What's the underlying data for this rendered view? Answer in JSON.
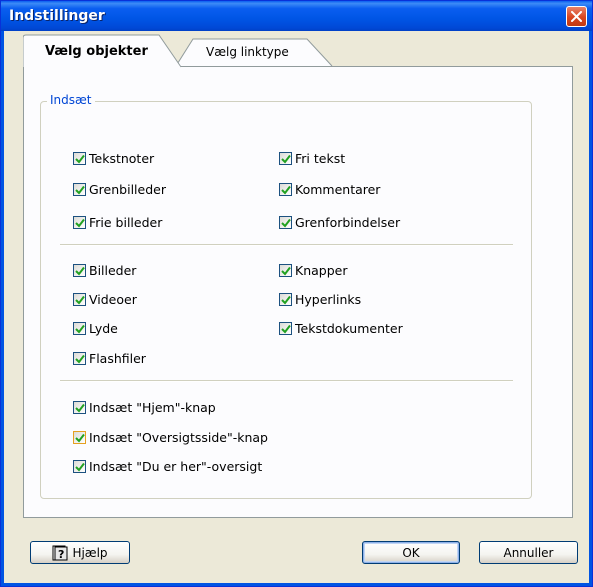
{
  "window": {
    "title": "Indstillinger"
  },
  "tabs": [
    {
      "label": "Vælg objekter",
      "active": true
    },
    {
      "label": "Vælg linktype",
      "active": false
    }
  ],
  "group": {
    "legend": "Indsæt"
  },
  "section1": {
    "left": [
      {
        "label": "Tekstnoter",
        "checked": true
      },
      {
        "label": "Grenbilleder",
        "checked": true
      },
      {
        "label": "Frie billeder",
        "checked": true
      }
    ],
    "right": [
      {
        "label": "Fri tekst",
        "checked": true
      },
      {
        "label": "Kommentarer",
        "checked": true
      },
      {
        "label": "Grenforbindelser",
        "checked": true
      }
    ]
  },
  "section2": {
    "left": [
      {
        "label": "Billeder",
        "checked": true
      },
      {
        "label": "Videoer",
        "checked": true
      },
      {
        "label": "Lyde",
        "checked": true
      },
      {
        "label": "Flashfiler",
        "checked": true
      }
    ],
    "right": [
      {
        "label": "Knapper",
        "checked": true
      },
      {
        "label": "Hyperlinks",
        "checked": true
      },
      {
        "label": "Tekstdokumenter",
        "checked": true
      }
    ]
  },
  "section3": [
    {
      "label": "Indsæt \"Hjem\"-knap",
      "checked": true
    },
    {
      "label": "Indsæt \"Oversigtsside\"-knap",
      "checked": true,
      "hover": true
    },
    {
      "label": "Indsæt \"Du er her\"-oversigt",
      "checked": true
    }
  ],
  "buttons": {
    "help": "Hjælp",
    "ok": "OK",
    "cancel": "Annuller"
  },
  "colors": {
    "titlebar": "#0054e3",
    "legend": "#0046d5",
    "checkmark": "#21a121",
    "close": "#d8451f"
  }
}
